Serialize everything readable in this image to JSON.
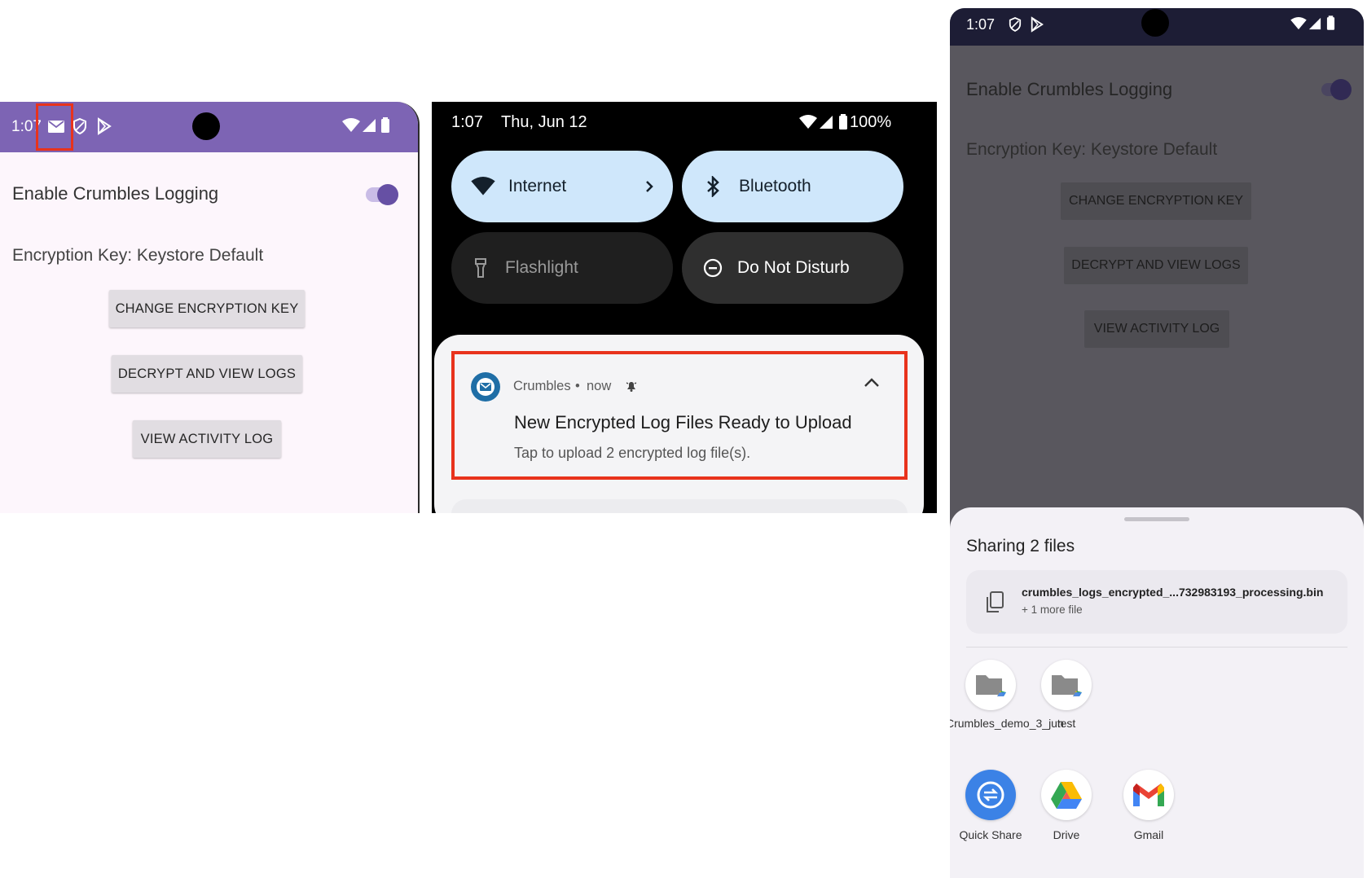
{
  "panel1": {
    "status": {
      "time": "1:07"
    },
    "toggle_label": "Enable Crumbles Logging",
    "encryption_label": "Encryption Key: Keystore Default",
    "buttons": {
      "change_key": "CHANGE ENCRYPTION KEY",
      "decrypt": "DECRYPT AND VIEW LOGS",
      "activity": "VIEW ACTIVITY LOG"
    },
    "colors": {
      "statusbar": "#7d64b4",
      "highlight": "#e8331c",
      "switch_thumb": "#6650a4"
    }
  },
  "panel2": {
    "status": {
      "time": "1:07",
      "date": "Thu, Jun 12",
      "battery": "100%"
    },
    "tiles": {
      "internet": "Internet",
      "bluetooth": "Bluetooth",
      "flashlight": "Flashlight",
      "dnd": "Do Not Disturb"
    },
    "notification": {
      "app": "Crumbles",
      "time": "now",
      "title": "New Encrypted Log Files Ready to Upload",
      "body": "Tap to upload 2 encrypted log file(s)."
    },
    "colors": {
      "tile_on": "#cfe7fb",
      "highlight": "#e8331c"
    }
  },
  "panel3": {
    "status": {
      "time": "1:07"
    },
    "toggle_label": "Enable Crumbles Logging",
    "encryption_label": "Encryption Key: Keystore Default",
    "buttons": {
      "change_key": "CHANGE ENCRYPTION KEY",
      "decrypt": "DECRYPT AND VIEW LOGS",
      "activity": "VIEW ACTIVITY LOG"
    },
    "share": {
      "title": "Sharing 2 files",
      "file_name": "crumbles_logs_encrypted_...732983193_processing.bin",
      "more": "+ 1 more file",
      "targets_row1": [
        {
          "label": "Crumbles_demo_3_jun",
          "icon": "drive-folder-icon"
        },
        {
          "label": "test",
          "icon": "drive-folder-icon"
        }
      ],
      "targets_row2": [
        {
          "label": "Quick Share",
          "icon": "quick-share-icon"
        },
        {
          "label": "Drive",
          "icon": "drive-icon"
        },
        {
          "label": "Gmail",
          "icon": "gmail-icon"
        }
      ]
    }
  }
}
